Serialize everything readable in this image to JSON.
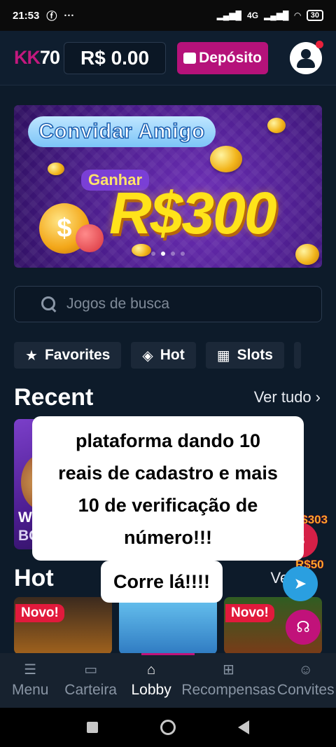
{
  "status": {
    "time": "21:53",
    "battery": "30",
    "signal": "4G"
  },
  "header": {
    "logo_kk": "KK",
    "logo_num": "70",
    "balance": "R$ 0.00",
    "deposit_label": "Depósito"
  },
  "banner": {
    "title": "Convidar Amigo",
    "earn": "Ganhar",
    "prize": "R$300",
    "slides": 4,
    "active_slide": 2
  },
  "search": {
    "placeholder": "Jogos de busca"
  },
  "categories": [
    {
      "label": "Favorites",
      "icon": "star-icon"
    },
    {
      "label": "Hot",
      "icon": "hot-icon"
    },
    {
      "label": "Slots",
      "icon": "slots-icon"
    }
  ],
  "recent": {
    "title": "Recent",
    "see_all": "Ver tudo",
    "game_line1": "Wild",
    "game_provider": "BGaming"
  },
  "hot": {
    "title": "Hot",
    "see_all": "Ver tu",
    "new_tag": "Novo!"
  },
  "overlay": {
    "line1": "plataforma dando 10",
    "line2": "reais de cadastro e mais",
    "line3": "10 de verificação de",
    "line4": "número!!!",
    "line5": "Corre lá!!!!"
  },
  "floats": {
    "redpack_amount": "R$303",
    "telegram_amount": "R$50"
  },
  "bottom_nav": [
    {
      "label": "Menu",
      "icon": "menu-icon"
    },
    {
      "label": "Carteira",
      "icon": "wallet-icon"
    },
    {
      "label": "Lobby",
      "icon": "home-icon"
    },
    {
      "label": "Recompensas",
      "icon": "gift-icon"
    },
    {
      "label": "Convites",
      "icon": "user-plus-icon"
    }
  ],
  "colors": {
    "brand": "#c2187e",
    "background": "#0d1b2a",
    "prize_yellow": "#ffe31a"
  }
}
